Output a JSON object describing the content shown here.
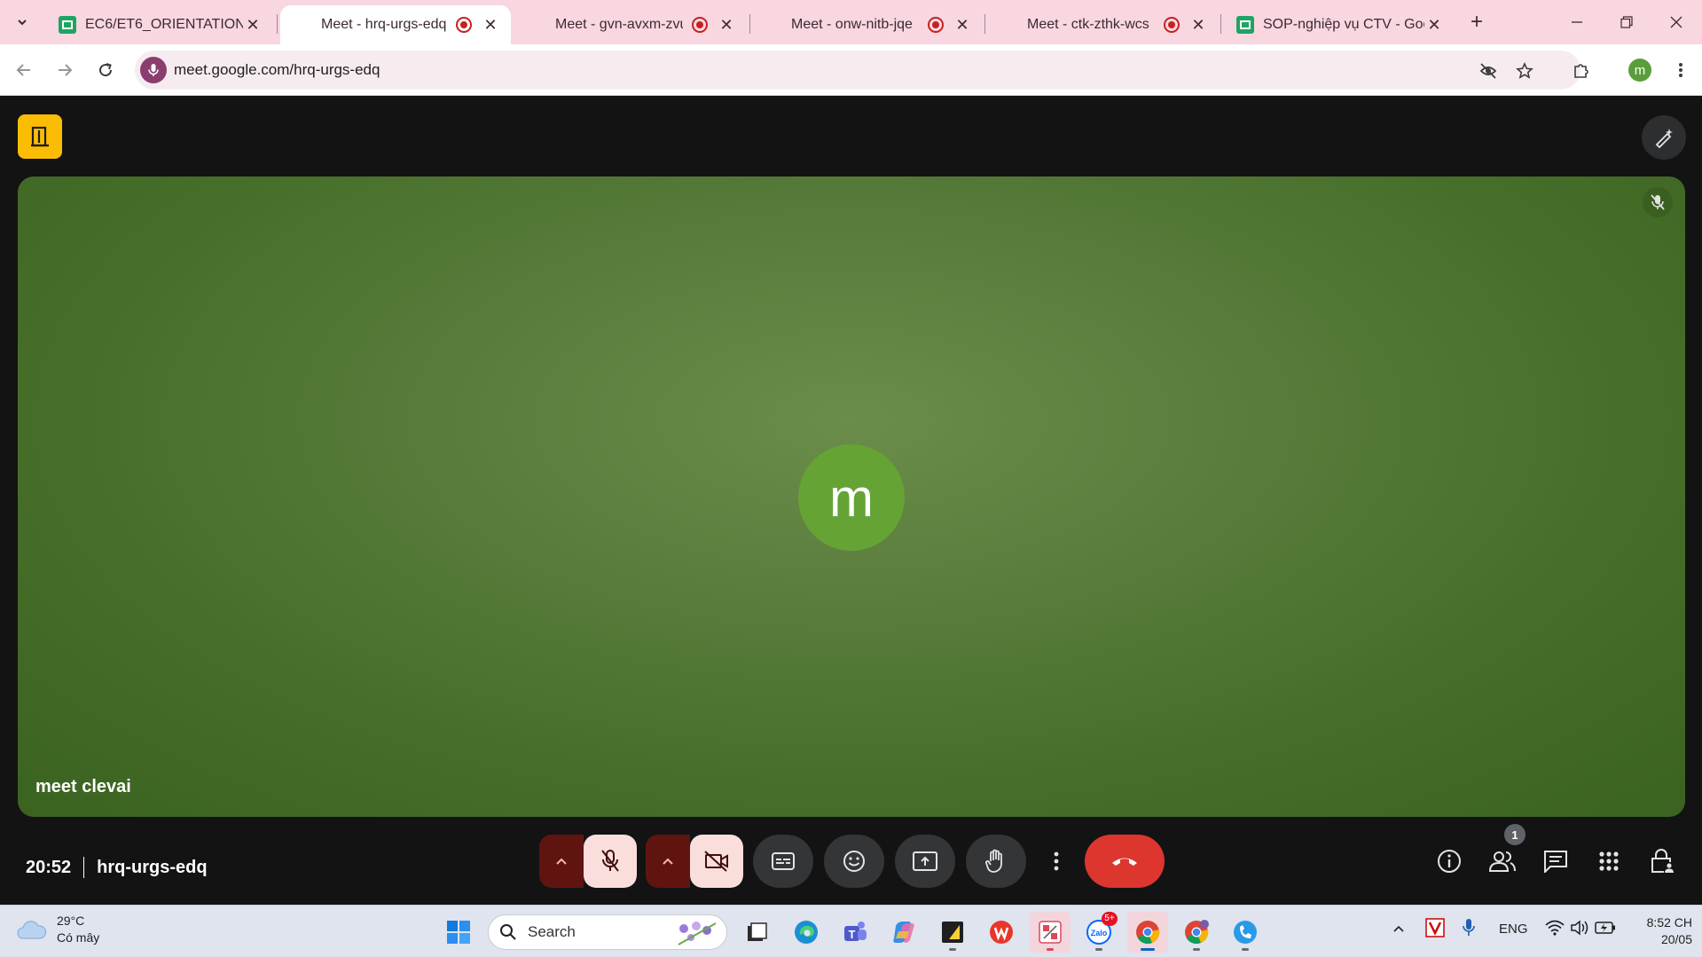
{
  "browser": {
    "tabs": [
      {
        "title": "EC6/ET6_ORIENTATION_Cl",
        "icon": "sheets-icon",
        "recording": false
      },
      {
        "title": "Meet - hrq-urgs-edq",
        "icon": "meet-icon",
        "recording": true,
        "active": true
      },
      {
        "title": "Meet - gvn-avxm-zvu",
        "icon": "meet-icon",
        "recording": true
      },
      {
        "title": "Meet - onw-nitb-jqe",
        "icon": "meet-icon",
        "recording": true
      },
      {
        "title": "Meet - ctk-zthk-wcs",
        "icon": "meet-icon",
        "recording": true
      },
      {
        "title": "SOP-nghiệp vụ CTV - Goo",
        "icon": "sheets-icon",
        "recording": false
      }
    ],
    "new_tab": "+",
    "close_glyph": "✕",
    "url": "meet.google.com/hrq-urgs-edq",
    "profile_initial": "m"
  },
  "meet": {
    "participant_name": "meet clevai",
    "participant_initial": "m",
    "time": "20:52",
    "meeting_code": "hrq-urgs-edq",
    "people_count": "1",
    "colors": {
      "tile": "#5b7e3e",
      "avatar": "#66a335",
      "leave": "#dc362e",
      "muted_bg": "#f9dedc",
      "muted_arrow": "#601410"
    }
  },
  "taskbar": {
    "weather_temp": "29°C",
    "weather_desc": "Có mây",
    "search_label": "Search",
    "zalo_badge": "5+",
    "language": "ENG",
    "clock_time": "8:52 CH",
    "clock_date": "20/05"
  }
}
